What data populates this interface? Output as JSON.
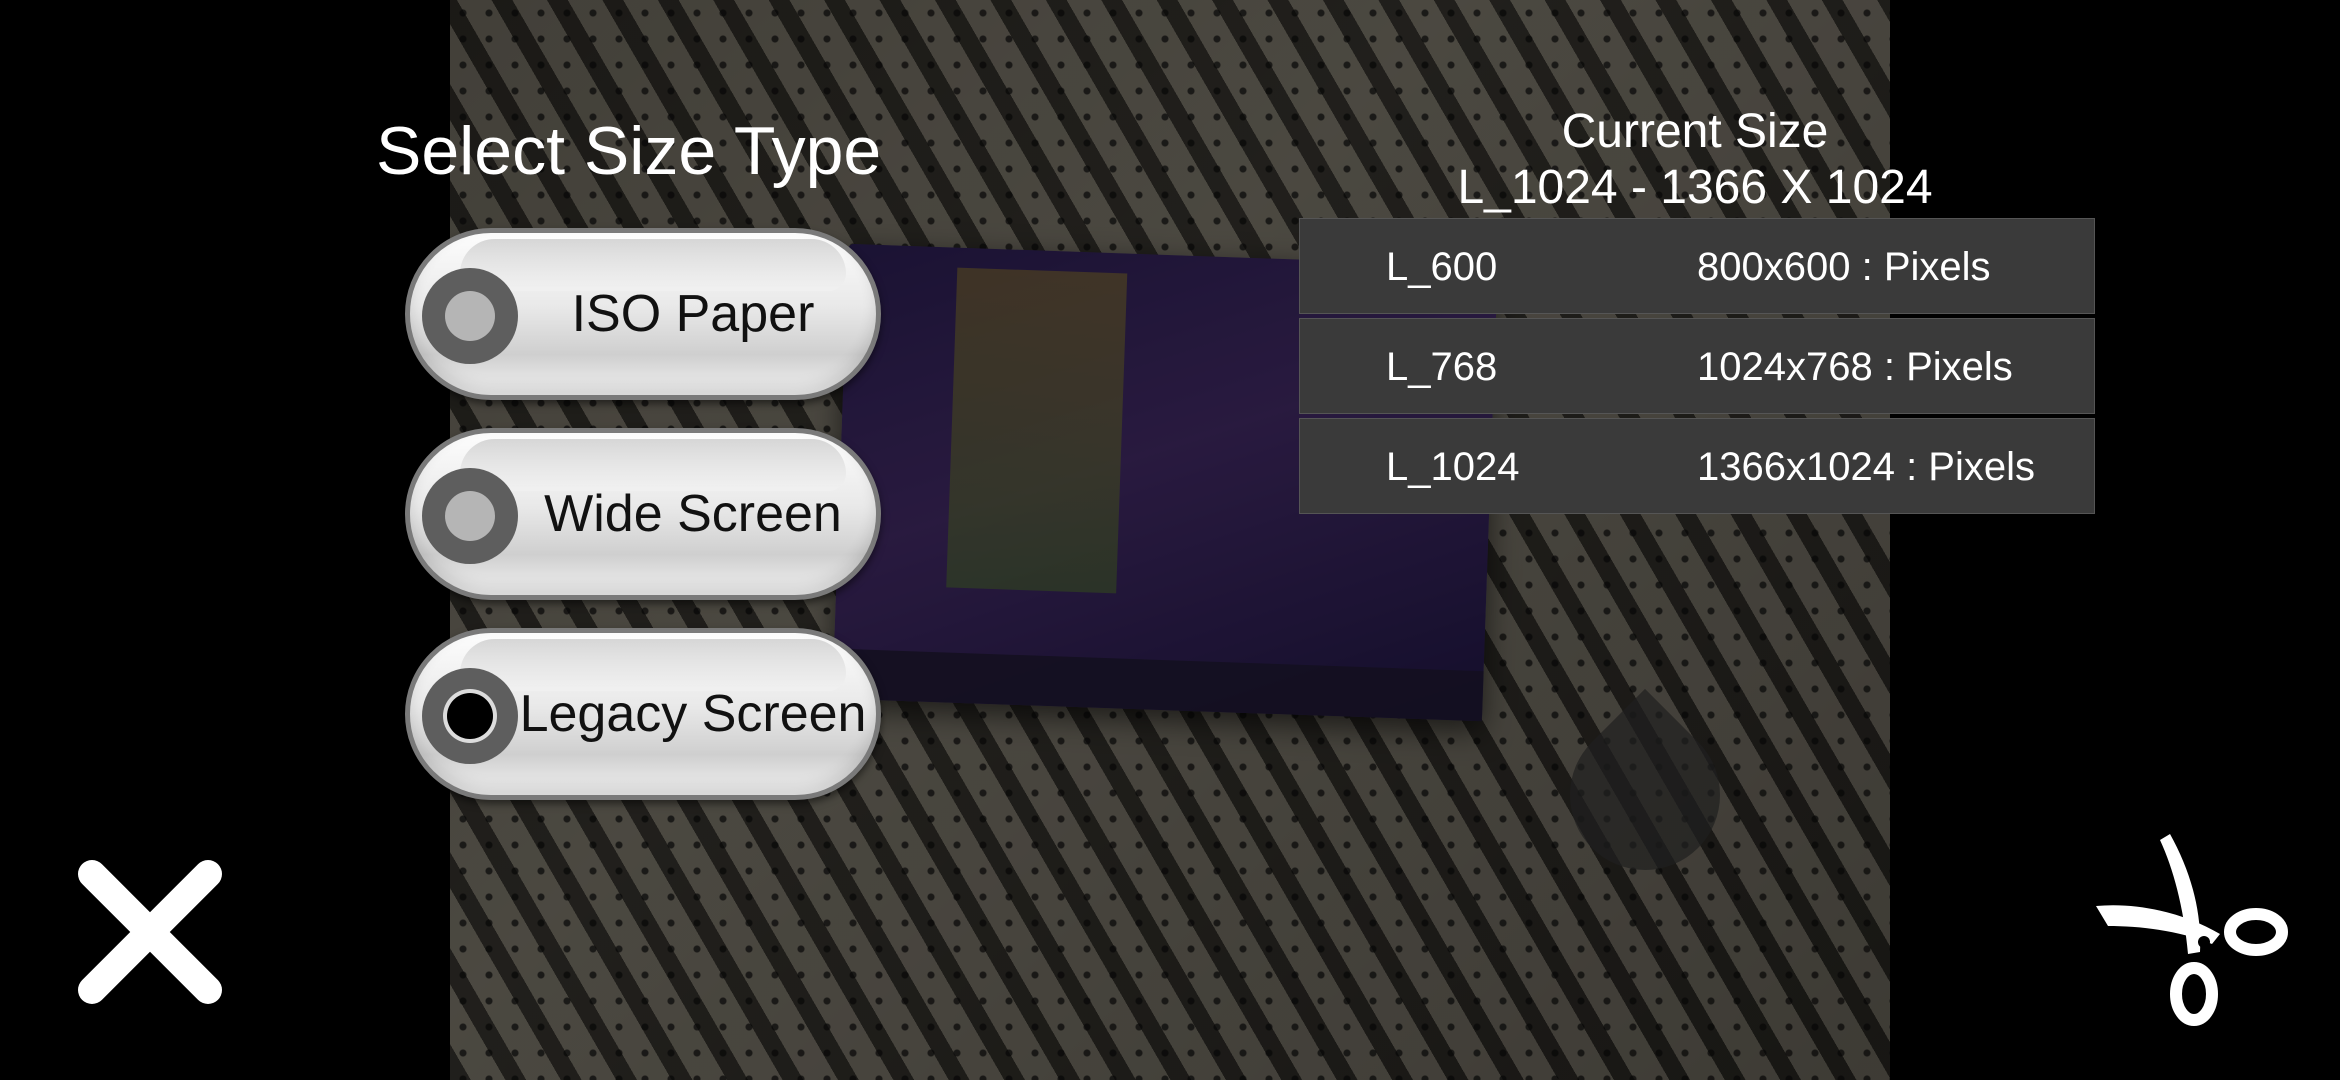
{
  "title": "Select Size Type",
  "size_types": [
    {
      "label": "ISO Paper",
      "selected": false
    },
    {
      "label": "Wide Screen",
      "selected": false
    },
    {
      "label": "Legacy Screen",
      "selected": true
    }
  ],
  "current_size": {
    "heading": "Current Size",
    "value": "L_1024 - 1366 X 1024"
  },
  "sizes": [
    {
      "name": "L_600",
      "dimensions": "800x600 : Pixels"
    },
    {
      "name": "L_768",
      "dimensions": "1024x768 : Pixels"
    },
    {
      "name": "L_1024",
      "dimensions": "1366x1024 : Pixels"
    }
  ],
  "icons": {
    "close": "close-icon",
    "crop": "scissors-icon"
  },
  "colors": {
    "row_background": "#3a3a3a",
    "text": "#ffffff",
    "pill": "#e9e9e9",
    "radio_ring": "#5e5e5e"
  }
}
